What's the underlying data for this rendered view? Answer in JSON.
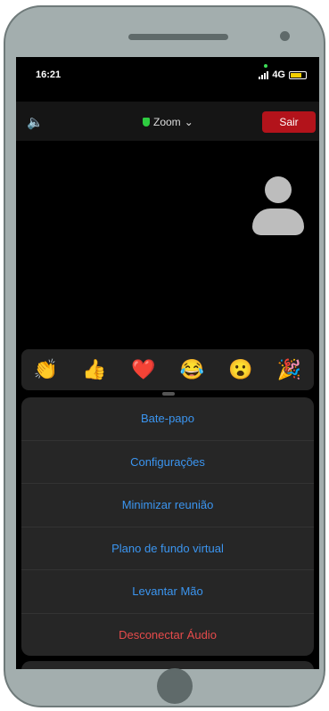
{
  "status": {
    "time": "16:21",
    "network": "4G"
  },
  "topbar": {
    "title": "Zoom",
    "leave_label": "Sair"
  },
  "reactions": [
    "👏",
    "👍",
    "❤️",
    "😂",
    "😮",
    "🎉"
  ],
  "menu": {
    "items": [
      "Bate-papo",
      "Configurações",
      "Minimizar reunião",
      "Plano de fundo virtual",
      "Levantar Mão",
      "Desconectar Áudio"
    ]
  },
  "colors": {
    "accent": "#3b95f0",
    "danger": "#e64b4b",
    "leave": "#b3131b"
  }
}
